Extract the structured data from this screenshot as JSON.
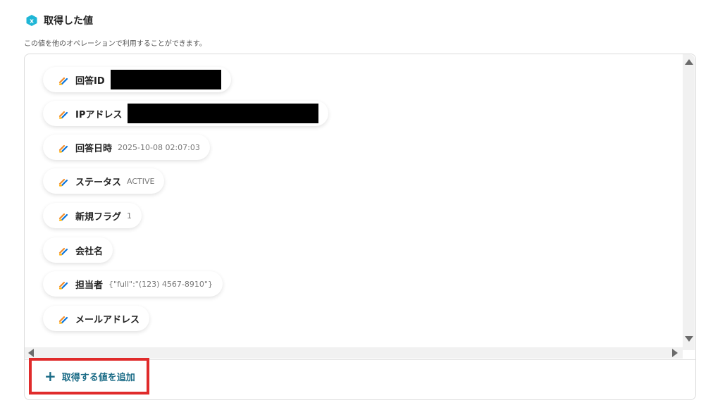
{
  "section": {
    "title": "取得した値",
    "subtitle": "この値を他のオペレーションで利用することができます。",
    "badge_icon": "x-hexagon-icon",
    "badge_color": "#1fb6d6"
  },
  "fields": [
    {
      "label": "回答ID",
      "value": "",
      "redacted": true
    },
    {
      "label": "IPアドレス",
      "value": "",
      "redacted": true
    },
    {
      "label": "回答日時",
      "value": "2025-10-08 02:07:03",
      "redacted": false
    },
    {
      "label": "ステータス",
      "value": "ACTIVE",
      "redacted": false
    },
    {
      "label": "新規フラグ",
      "value": "1",
      "redacted": false
    },
    {
      "label": "会社名",
      "value": "",
      "redacted": false
    },
    {
      "label": "担当者",
      "value": "{\"full\":\"(123) 4567-8910\"}",
      "redacted": false
    },
    {
      "label": "メールアドレス",
      "value": "",
      "redacted": false
    }
  ],
  "field_icon": "jotform-icon",
  "add_button": {
    "label": "取得する値を追加",
    "icon": "plus-icon",
    "color": "#1a6b86",
    "highlight_color": "#e02b2b"
  }
}
